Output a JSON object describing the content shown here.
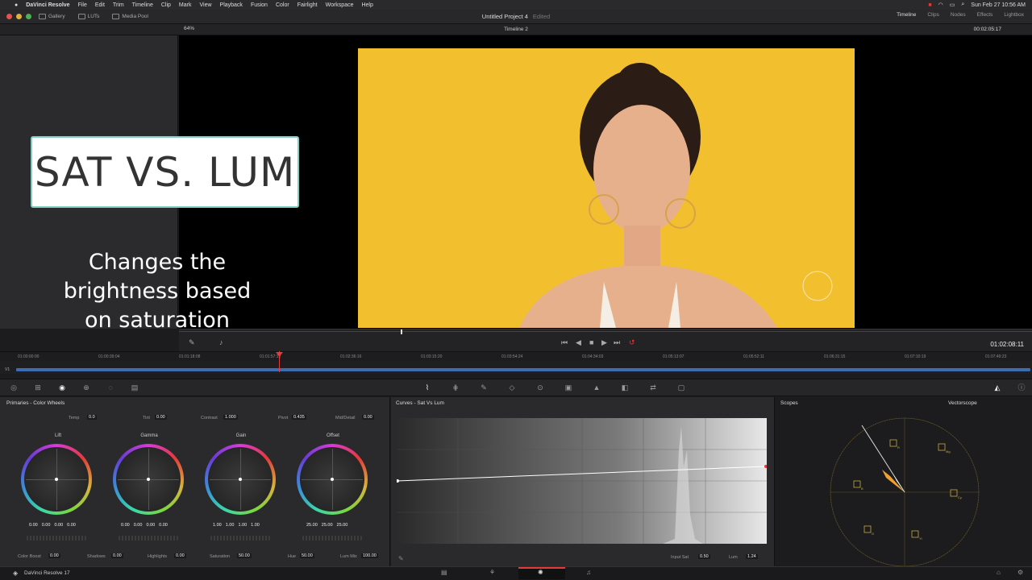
{
  "menubar": {
    "app": "DaVinci Resolve",
    "items": [
      "File",
      "Edit",
      "Trim",
      "Timeline",
      "Clip",
      "Mark",
      "View",
      "Playback",
      "Fusion",
      "Color",
      "Fairlight",
      "Workspace",
      "Help"
    ],
    "clock": "Sun Feb 27  10:56 AM"
  },
  "toolbar": {
    "gallery": "Gallery",
    "luts": "LUTs",
    "media_pool": "Media Pool",
    "project_title": "Untitled Project 4",
    "project_status": "Edited",
    "right": [
      "Timeline",
      "Clips",
      "Nodes",
      "Effects",
      "Lightbox"
    ]
  },
  "viewer": {
    "zoom": "64%",
    "timeline_name": "Timeline 2",
    "timecode_top": "00:02:05:17",
    "timecode_main": "01:02:08:11"
  },
  "overlay": {
    "title": "SAT VS. LUM",
    "description_lines": [
      "Changes the",
      "brightness based",
      "on saturation"
    ]
  },
  "ruler": {
    "ticks": [
      "01:00:00:00",
      "01:00:39:04",
      "01:01:18:08",
      "01:01:57:12",
      "01:02:36:16",
      "01:03:15:20",
      "01:03:54:24",
      "01:04:34:03",
      "01:05:13:07",
      "01:05:52:11",
      "01:06:31:15",
      "01:07:10:19",
      "01:07:49:23"
    ],
    "track": "V1"
  },
  "primaries": {
    "title": "Primaries - Color Wheels",
    "temp_label": "Temp",
    "temp": "0.0",
    "tint_label": "Tint",
    "tint": "0.00",
    "contrast_label": "Contrast",
    "contrast": "1.000",
    "pivot_label": "Pivot",
    "pivot": "0.435",
    "middetail_label": "Mid/Detail",
    "middetail": "0.00",
    "wheels": [
      {
        "name": "Lift",
        "values": [
          "0.00",
          "0.00",
          "0.00",
          "0.00"
        ]
      },
      {
        "name": "Gamma",
        "values": [
          "0.00",
          "0.00",
          "0.00",
          "0.00"
        ]
      },
      {
        "name": "Gain",
        "values": [
          "1.00",
          "1.00",
          "1.00",
          "1.00"
        ]
      },
      {
        "name": "Offset",
        "values": [
          "25.00",
          "25.00",
          "25.00"
        ]
      }
    ],
    "colorboost_label": "Color Boost",
    "colorboost": "0.00",
    "shadows_label": "Shadows",
    "shadows": "0.00",
    "highlights_label": "Highlights",
    "highlights": "0.00",
    "saturation_label": "Saturation",
    "saturation": "50.00",
    "hue_label": "Hue",
    "hue": "50.00",
    "lummix_label": "Lum Mix",
    "lummix": "100.00"
  },
  "curves": {
    "title": "Curves - Sat Vs Lum",
    "input_sat_label": "Input Sat",
    "input_sat": "0.50",
    "lum_label": "Lum",
    "lum": "1.24"
  },
  "scopes": {
    "title": "Scopes",
    "mode": "Vectorscope",
    "targets": [
      "R",
      "Mg",
      "B",
      "Cy",
      "G",
      "Yl"
    ]
  },
  "status": {
    "label": "DaVinci Resolve 17"
  },
  "colors": {
    "accent_red": "#e63a3a",
    "clip_blue": "#3d6cb3",
    "backdrop_yellow": "#f2bf2e",
    "title_border": "#7fd0c3"
  }
}
